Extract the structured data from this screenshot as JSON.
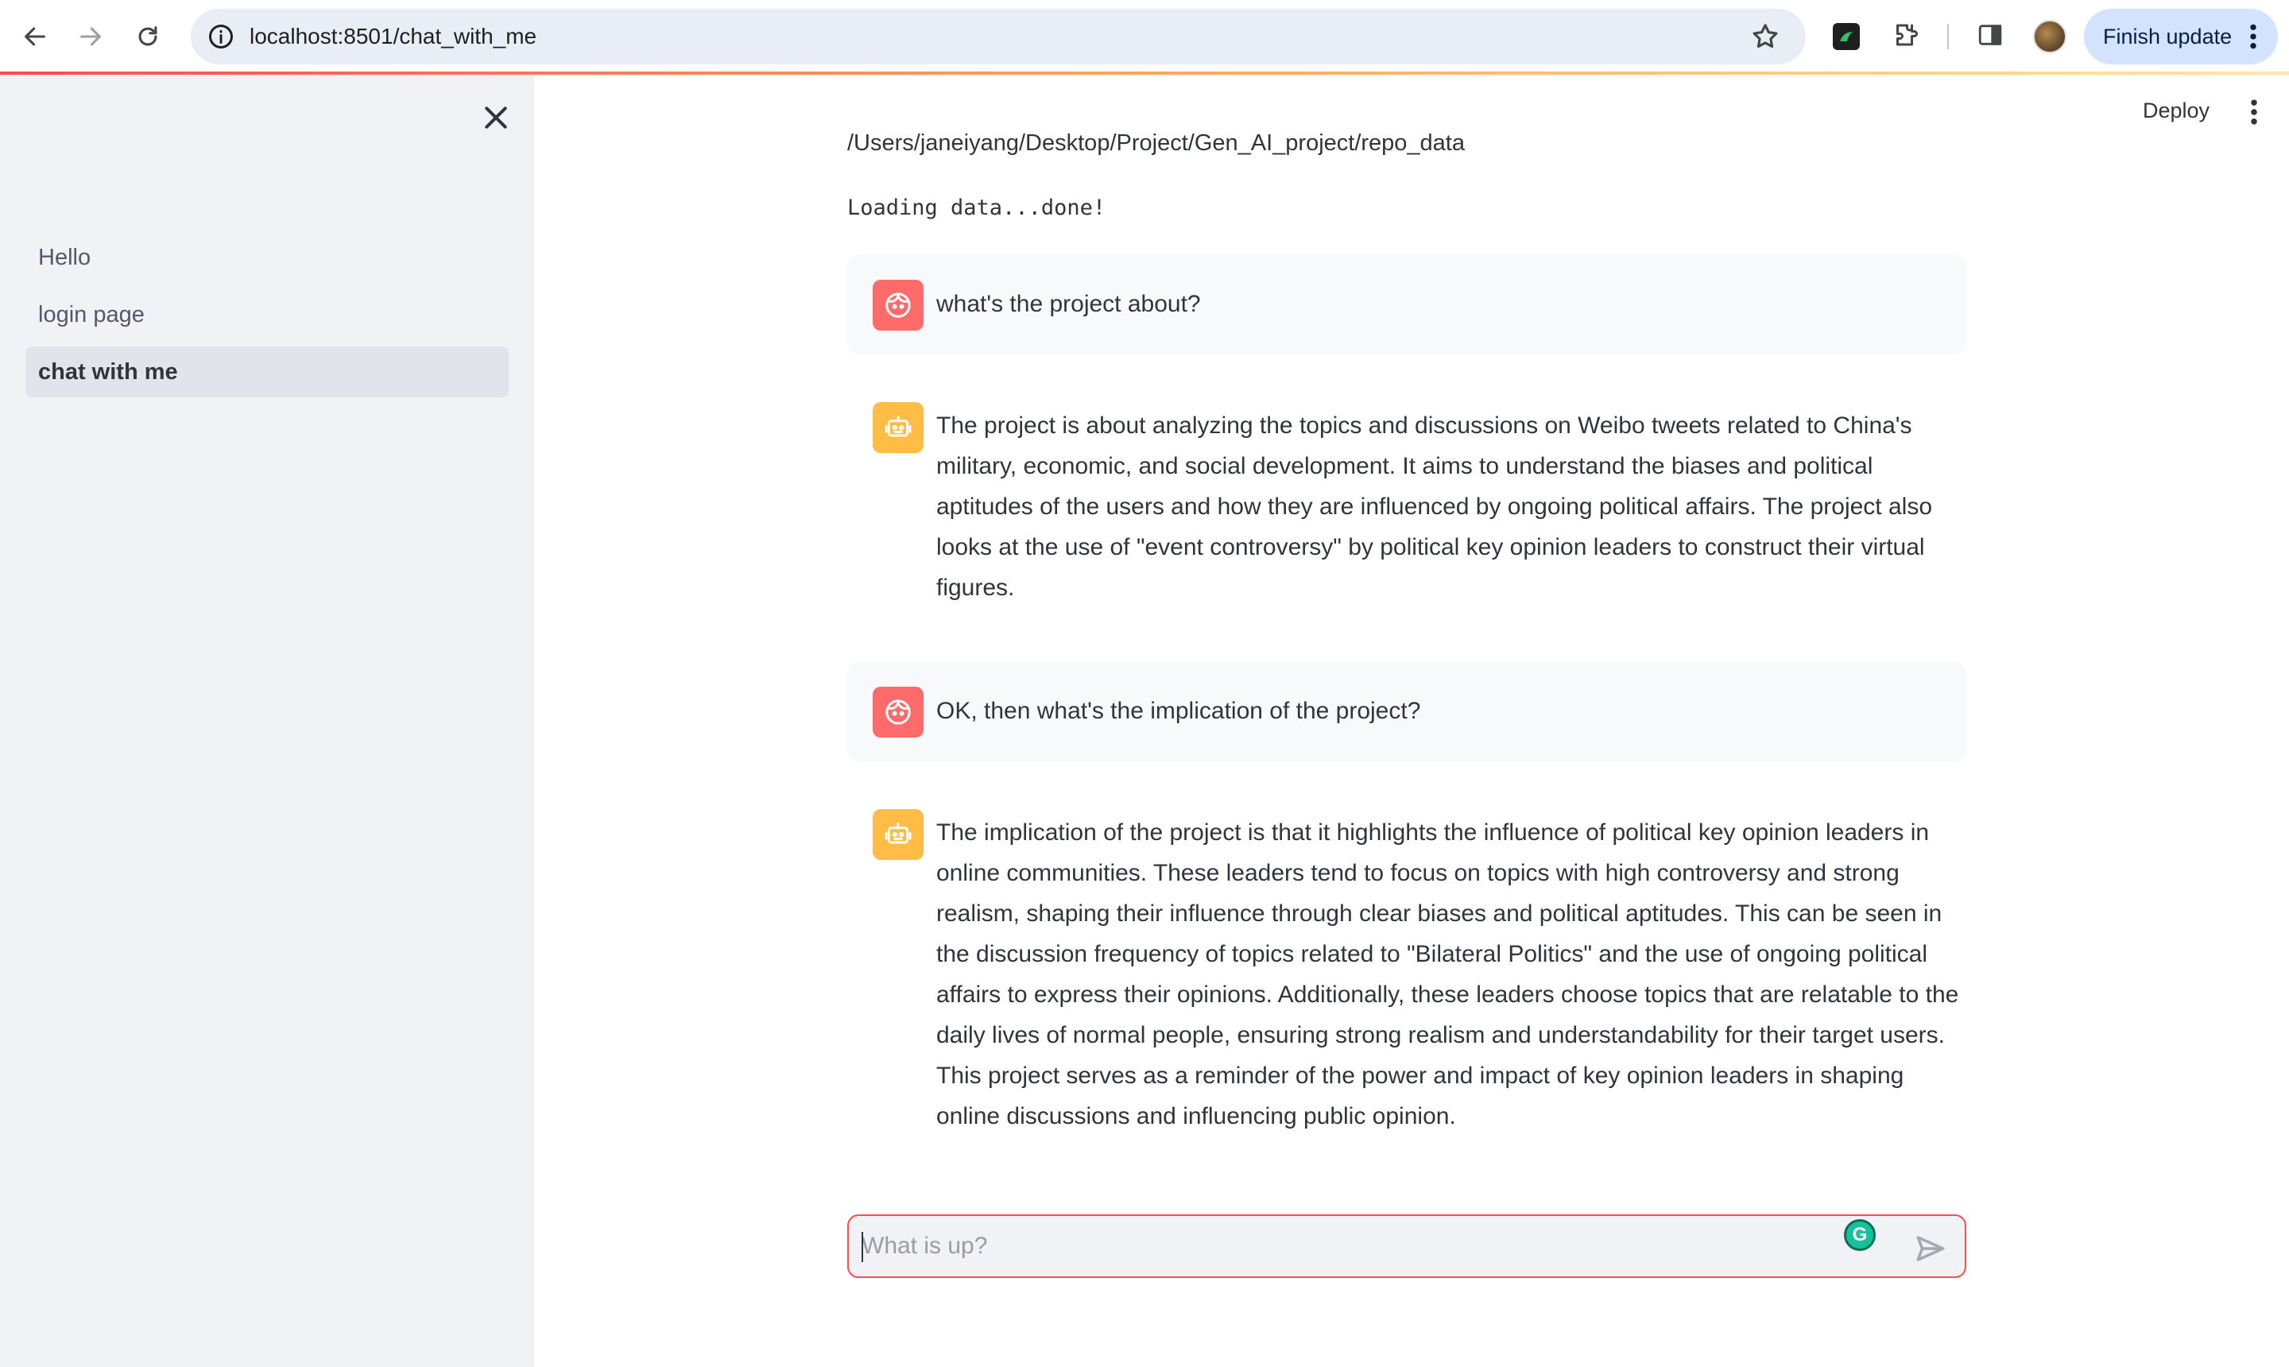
{
  "browser": {
    "url": "localhost:8501/chat_with_me",
    "finish_update_label": "Finish update",
    "icons": [
      "back-icon",
      "forward-icon",
      "reload-icon",
      "site-info-icon",
      "bookmark-star-icon",
      "extension-icon",
      "puzzle-icon",
      "side-panel-icon",
      "profile-avatar",
      "more-vert-icon"
    ]
  },
  "sidebar": {
    "items": [
      {
        "label": "Hello",
        "active": false
      },
      {
        "label": "login page",
        "active": false
      },
      {
        "label": "chat with me",
        "active": true
      }
    ]
  },
  "header": {
    "deploy_label": "Deploy"
  },
  "main": {
    "path_text": "/Users/janeiyang/Desktop/Project/Gen_AI_project/repo_data",
    "loading_text": "Loading data...done!",
    "messages": [
      {
        "role": "user",
        "text": "what's the project about?"
      },
      {
        "role": "assistant",
        "text": "The project is about analyzing the topics and discussions on Weibo tweets related to China's military, economic, and social development. It aims to understand the biases and political aptitudes of the users and how they are influenced by ongoing political affairs. The project also looks at the use of \"event controversy\" by political key opinion leaders to construct their virtual figures."
      },
      {
        "role": "user",
        "text": "OK, then what's the implication of the project?"
      },
      {
        "role": "assistant",
        "text": "The implication of the project is that it highlights the influence of political key opinion leaders in online communities. These leaders tend to focus on topics with high controversy and strong realism, shaping their influence through clear biases and political aptitudes. This can be seen in the discussion frequency of topics related to \"Bilateral Politics\" and the use of ongoing political affairs to express their opinions. Additionally, these leaders choose topics that are relatable to the daily lives of normal people, ensuring strong realism and understandability for their target users. This project serves as a reminder of the power and impact of key opinion leaders in shaping online discussions and influencing public opinion."
      }
    ]
  },
  "chat_input": {
    "placeholder": "What is up?",
    "value": ""
  },
  "colors": {
    "accent": "#ff4b4b",
    "user_avatar": "#ff6b6b",
    "bot_avatar": "#ffbd45",
    "sidebar_bg": "#f0f2f6"
  }
}
